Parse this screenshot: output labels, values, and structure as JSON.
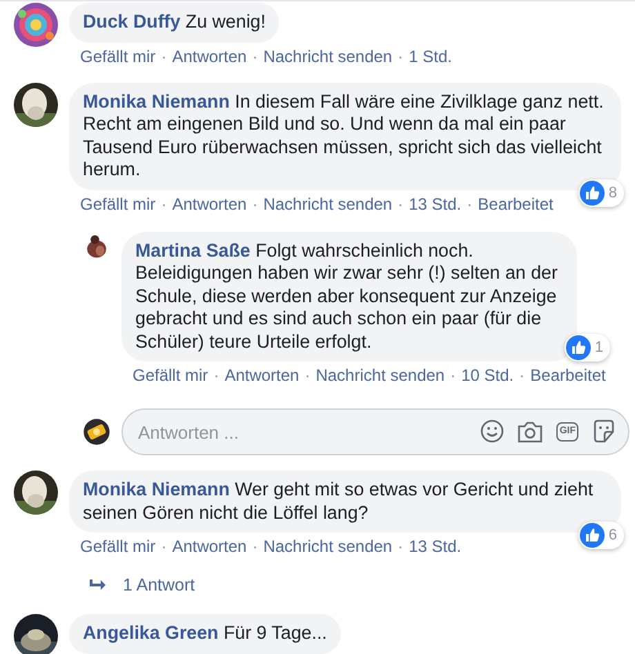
{
  "separator": "·",
  "comments": [
    {
      "author": "Duck Duffy",
      "text": "Zu wenig!",
      "actions": [
        "Gefällt mir",
        "Antworten",
        "Nachricht senden"
      ],
      "time": "1 Std."
    },
    {
      "author": "Monika Niemann",
      "text": "In diesem Fall wäre eine Zivilklage ganz nett. Recht am eingenen Bild und so. Und wenn da mal ein paar Tausend Euro rüberwachsen müssen, spricht sich das vielleicht herum.",
      "actions": [
        "Gefällt mir",
        "Antworten",
        "Nachricht senden"
      ],
      "time": "13 Std.",
      "edited": "Bearbeitet",
      "likes": "8",
      "replies": [
        {
          "author": "Martina Saße",
          "text": "Folgt wahrscheinlich noch. Beleidigungen haben wir zwar sehr (!) selten an der Schule, diese werden aber konsequent zur Anzeige gebracht und es sind auch schon ein paar (für die Schüler) teure Urteile erfolgt.",
          "actions": [
            "Gefällt mir",
            "Antworten",
            "Nachricht senden"
          ],
          "time": "10 Std.",
          "edited": "Bearbeitet",
          "likes": "1"
        }
      ],
      "reply_box": {
        "placeholder": "Antworten ...",
        "gif_label": "GIF"
      }
    },
    {
      "author": "Monika Niemann",
      "text": "Wer geht mit so etwas vor Gericht und zieht seinen Gören nicht die Löffel lang?",
      "actions": [
        "Gefällt mir",
        "Antworten",
        "Nachricht senden"
      ],
      "time": "13 Std.",
      "likes": "6",
      "replies_link": "1 Antwort"
    },
    {
      "author": "Angelika Green",
      "text": "Für 9 Tage..."
    }
  ]
}
